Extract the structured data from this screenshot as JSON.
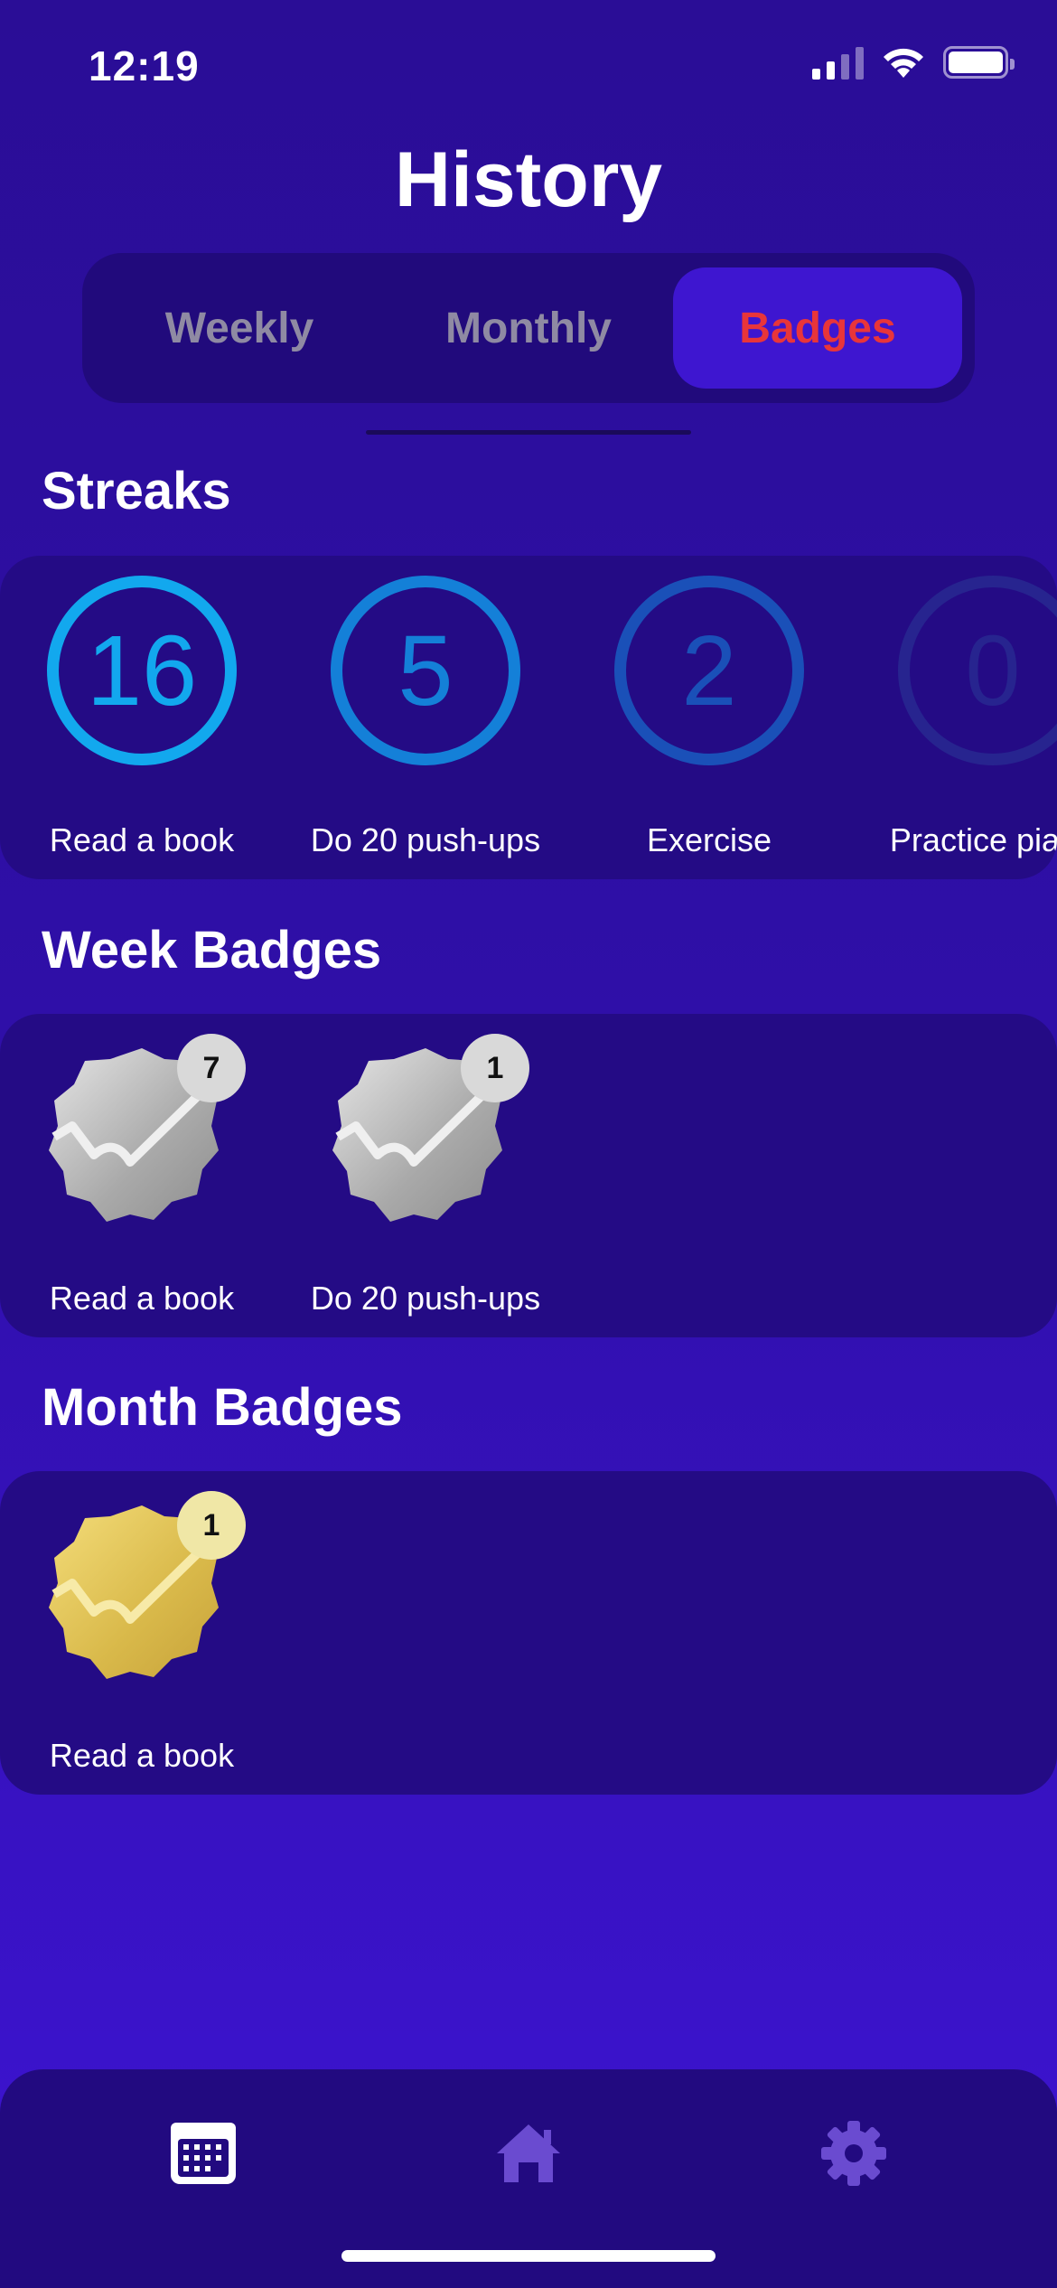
{
  "status": {
    "time": "12:19"
  },
  "title": "History",
  "segments": [
    {
      "label": "Weekly",
      "active": false
    },
    {
      "label": "Monthly",
      "active": false
    },
    {
      "label": "Badges",
      "active": true
    }
  ],
  "streaks": {
    "title": "Streaks",
    "items": [
      {
        "count": "16",
        "label": "Read a book",
        "color": "#12a8ee"
      },
      {
        "count": "5",
        "label": "Do 20 push-ups",
        "color": "#1480d8"
      },
      {
        "count": "2",
        "label": "Exercise",
        "color": "#1a50b8"
      },
      {
        "count": "0",
        "label": "Practice piano",
        "color": "#27248f"
      }
    ]
  },
  "week_badges": {
    "title": "Week Badges",
    "items": [
      {
        "count": "7",
        "label": "Read a book",
        "tier": "silver"
      },
      {
        "count": "1",
        "label": "Do 20 push-ups",
        "tier": "silver"
      }
    ]
  },
  "month_badges": {
    "title": "Month Badges",
    "items": [
      {
        "count": "1",
        "label": "Read a book",
        "tier": "gold"
      }
    ]
  },
  "tab_bar": {
    "items": [
      {
        "icon": "calendar-icon",
        "active": true
      },
      {
        "icon": "home-icon",
        "active": false
      },
      {
        "icon": "gear-icon",
        "active": false
      }
    ]
  },
  "colors": {
    "background": "#2f0fa8",
    "card": "#240b85",
    "active_segment": "#3e16d0",
    "active_segment_text": "#e8353a",
    "inactive_text": "#8f8aa3",
    "silver": "#b5b5b5",
    "gold": "#e3c65a"
  }
}
